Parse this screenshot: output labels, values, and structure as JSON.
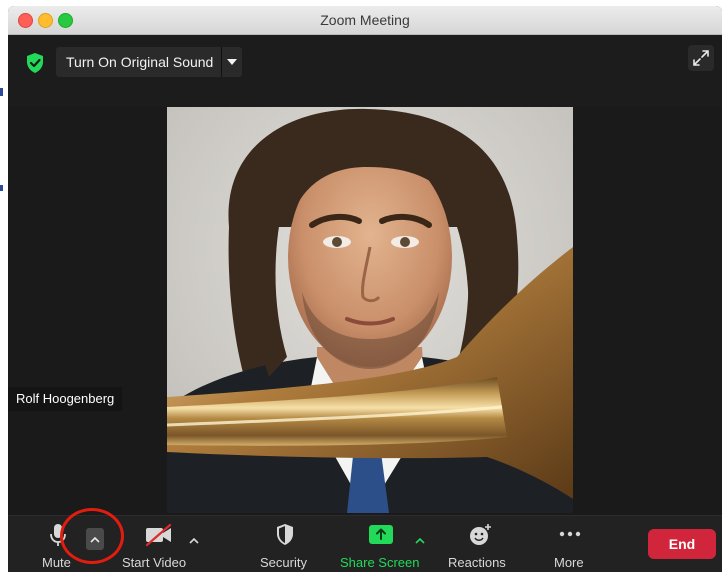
{
  "window": {
    "title": "Zoom Meeting"
  },
  "topbar": {
    "original_sound_label": "Turn On Original Sound"
  },
  "video": {
    "participant_name": "Rolf Hoogenberg"
  },
  "toolbar": {
    "mute_label": "Mute",
    "start_video_label": "Start Video",
    "security_label": "Security",
    "share_screen_label": "Share Screen",
    "reactions_label": "Reactions",
    "more_label": "More",
    "end_label": "End"
  },
  "colors": {
    "accent_green": "#23d959",
    "end_red": "#d0253a",
    "annotation_red": "#e21d10"
  },
  "icons": [
    "shield-check-icon",
    "chevron-down-icon",
    "expand-icon",
    "microphone-icon",
    "chevron-up-icon",
    "video-off-icon",
    "shield-icon",
    "share-arrow-icon",
    "emoji-plus-icon",
    "more-dots-icon"
  ]
}
